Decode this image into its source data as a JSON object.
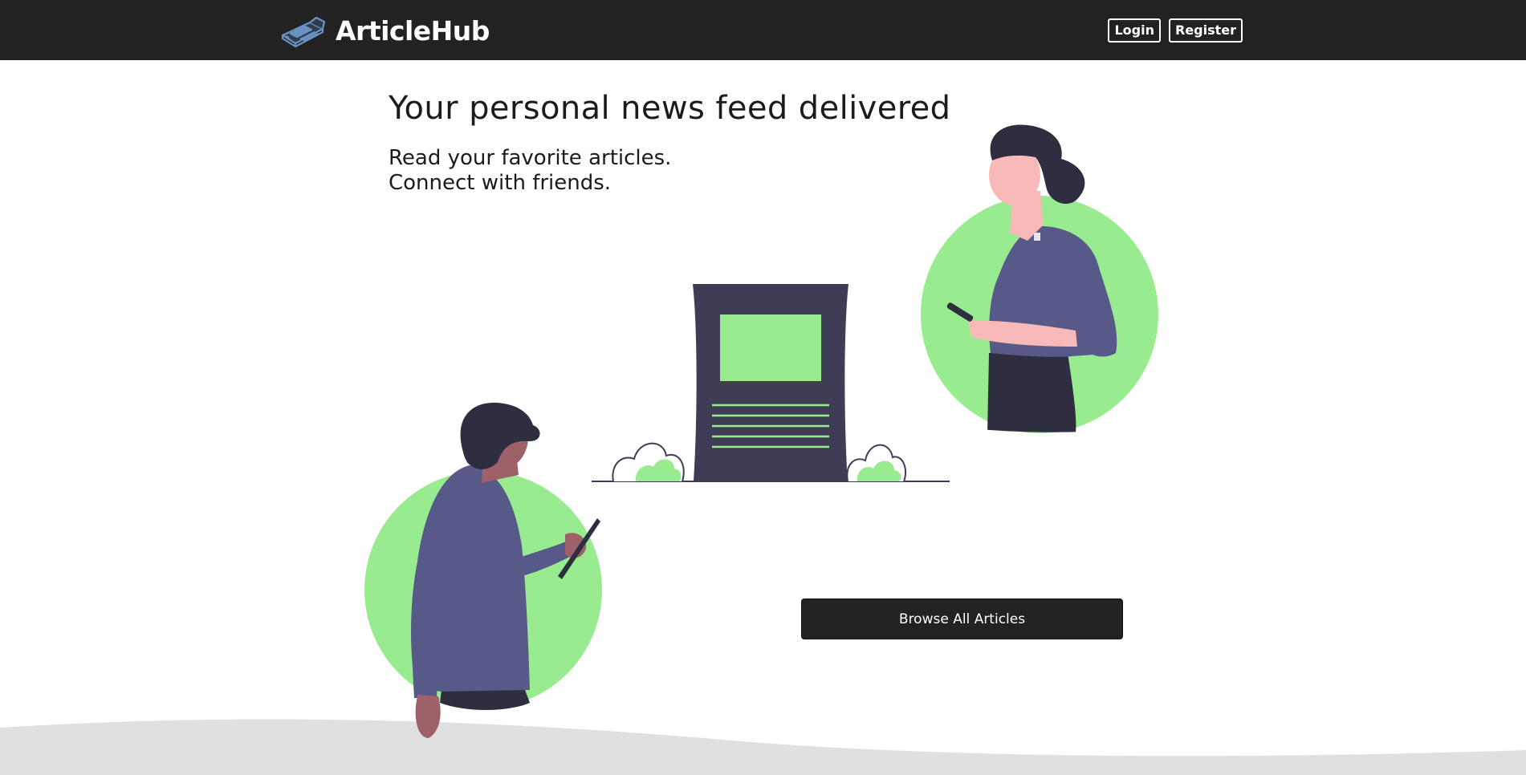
{
  "brand": {
    "name": "ArticleHub",
    "icon": "newspaper-icon"
  },
  "nav": {
    "login_label": "Login",
    "register_label": "Register"
  },
  "hero": {
    "headline": "Your personal news feed delivered",
    "subline_1": "Read your favorite articles.",
    "subline_2": "Connect with friends."
  },
  "cta": {
    "browse_label": "Browse All Articles"
  },
  "colors": {
    "navbar": "#222222",
    "accent_green": "#98ec8f",
    "dark_slate": "#3f3d56",
    "purple": "#575a89",
    "wave_gray": "#e0e0e0"
  }
}
